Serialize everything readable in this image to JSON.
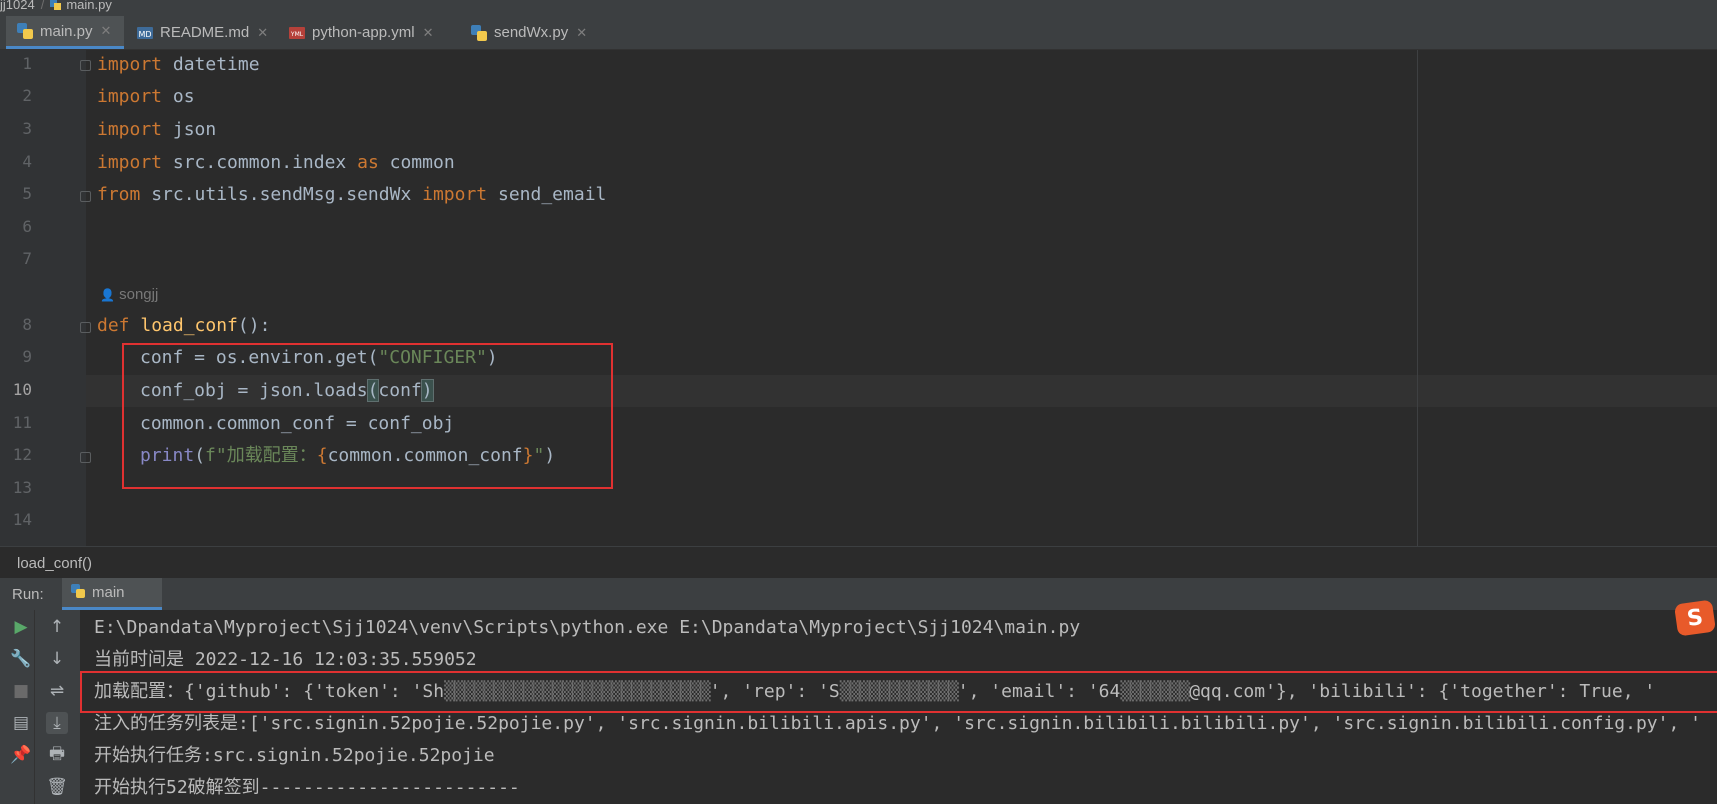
{
  "breadcrumb": {
    "project": "jj1024",
    "file": "main.py"
  },
  "tabs": [
    {
      "label": "main.py",
      "icon": "python-file-icon",
      "active": true
    },
    {
      "label": "README.md",
      "icon": "markdown-file-icon",
      "active": false
    },
    {
      "label": "python-app.yml",
      "icon": "yaml-file-icon",
      "active": false
    },
    {
      "label": "sendWx.py",
      "icon": "python-file-icon",
      "active": false
    }
  ],
  "editor": {
    "line_numbers": [
      "1",
      "2",
      "3",
      "4",
      "5",
      "6",
      "7",
      "8",
      "9",
      "10",
      "11",
      "12",
      "13",
      "14"
    ],
    "current_line": "10",
    "author_hint": "songjj",
    "code": {
      "l1_kw": "import",
      "l1_rest": " datetime",
      "l2_kw": "import",
      "l2_rest": " os",
      "l3_kw": "import",
      "l3_rest": " json",
      "l4_kw": "import",
      "l4_mid": " src.common.index ",
      "l4_as": "as",
      "l4_rest": " common",
      "l5_kw": "from",
      "l5_mid": " src.utils.sendMsg.sendWx ",
      "l5_imp": "import",
      "l5_rest": " send_email",
      "l8_kw": "def",
      "l8_fn": "load_conf",
      "l8_rest": "():",
      "l9_a": "conf = os.environ.get(",
      "l9_str": "\"CONFIGER\"",
      "l9_b": ")",
      "l10_a": "conf_obj = json.loads",
      "l10_p1": "(",
      "l10_b": "conf",
      "l10_p2": ")",
      "l11": "common.common_conf = conf_obj",
      "l12_print": "print",
      "l12_p": "(",
      "l12_f": "f\"加载配置：",
      "l12_lb": "{",
      "l12_expr": "common.common_conf",
      "l12_rb": "}",
      "l12_end": "\"",
      "l12_close": ")"
    }
  },
  "scope": {
    "function": "load_conf()"
  },
  "run": {
    "label": "Run:",
    "config_name": "main",
    "console": {
      "l1": "E:\\Dpandata\\Myproject\\Sjj1024\\venv\\Scripts\\python.exe E:\\Dpandata\\Myproject\\Sjj1024\\main.py",
      "l2": "当前时间是 2022-12-16 12:03:35.559052",
      "l3_a": "加载配置：{'github': {'token': 'Sh",
      "l3_m1": "▒▒▒▒▒▒▒▒▒▒▒▒▒▒▒▒▒▒▒▒▒▒▒▒▒▒▒",
      "l3_b": "', 'rep': 'S",
      "l3_m2": "▒▒▒▒▒▒▒▒▒▒▒▒",
      "l3_c": "', 'email': '64",
      "l3_m3": "▒▒▒▒▒▒▒",
      "l3_d": "@qq.com'}, 'bilibili': {'together': True, '",
      "l4": "注入的任务列表是:['src.signin.52pojie.52pojie.py', 'src.signin.bilibili.apis.py', 'src.signin.bilibili.bilibili.py', 'src.signin.bilibili.config.py', '",
      "l5": "开始执行任务:src.signin.52pojie.52pojie",
      "l6": "开始执行52破解签到------------------------"
    }
  },
  "colors": {
    "keyword": "#cc7832",
    "function": "#ffc66d",
    "string": "#6a8759",
    "builtin": "#8888c6",
    "highlight_box": "#e03131",
    "accent": "#4a88c7"
  }
}
